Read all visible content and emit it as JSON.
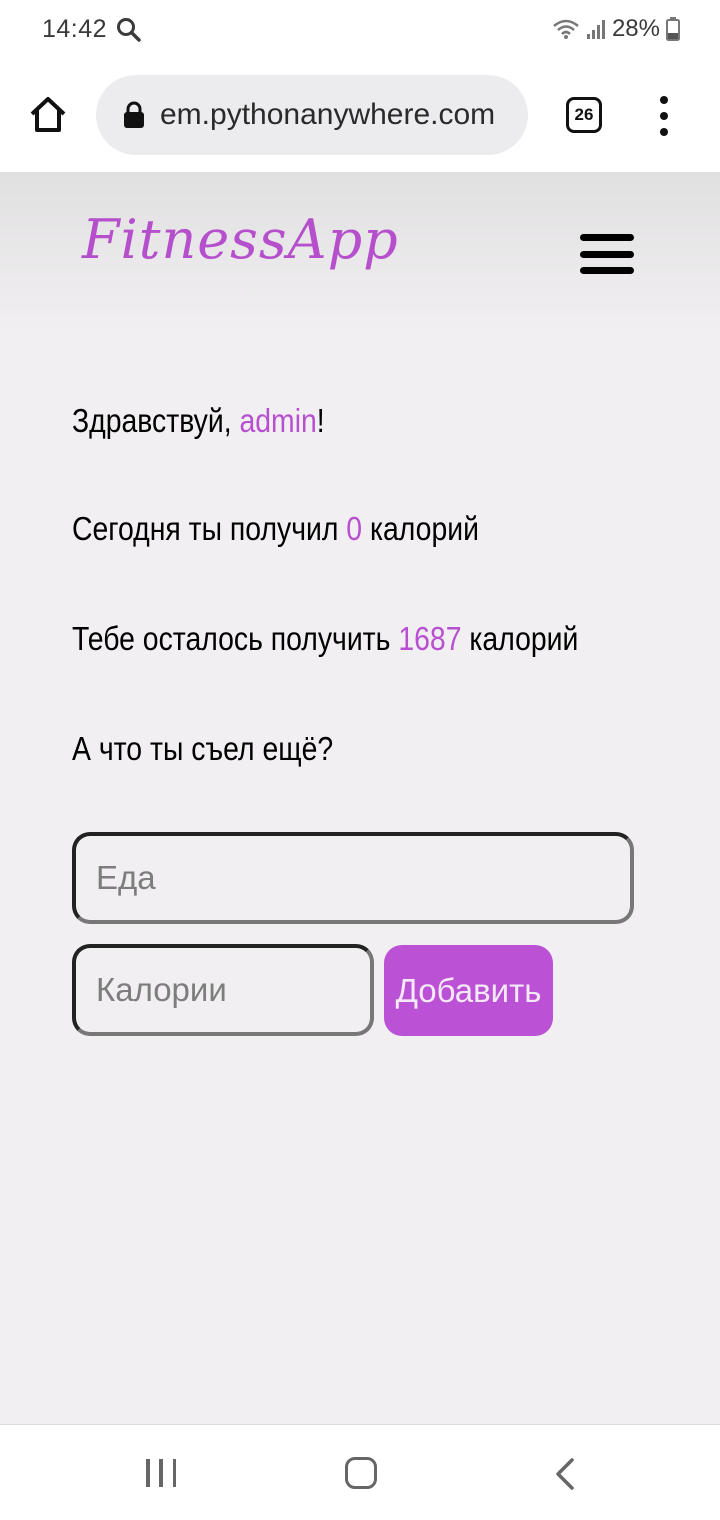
{
  "status_bar": {
    "time": "14:42",
    "battery": "28%",
    "icons": [
      "search-icon",
      "wifi-icon",
      "signal-icon",
      "battery-icon"
    ]
  },
  "browser": {
    "url": "em.pythonanywhere.com",
    "tab_count": "26",
    "icons": [
      "home-icon",
      "lock-icon",
      "tabs-icon",
      "more-menu-icon"
    ]
  },
  "site": {
    "logo": "FitnessApp",
    "accent_color": "#b84fd0",
    "greeting_prefix": "Здравствуй, ",
    "username": "admin",
    "greeting_suffix": "!",
    "today_prefix": "Сегодня ты получил ",
    "today_calories": "0",
    "today_suffix": " калорий",
    "remaining_prefix": "Тебе осталось получить ",
    "remaining_calories": "1687",
    "remaining_suffix": " калорий",
    "question": "А что ты съел ещё?"
  },
  "form": {
    "food_placeholder": "Еда",
    "calories_placeholder": "Калории",
    "add_label": "Добавить"
  },
  "nav": {
    "icons": [
      "recent-apps-icon",
      "home-icon",
      "back-icon"
    ]
  }
}
